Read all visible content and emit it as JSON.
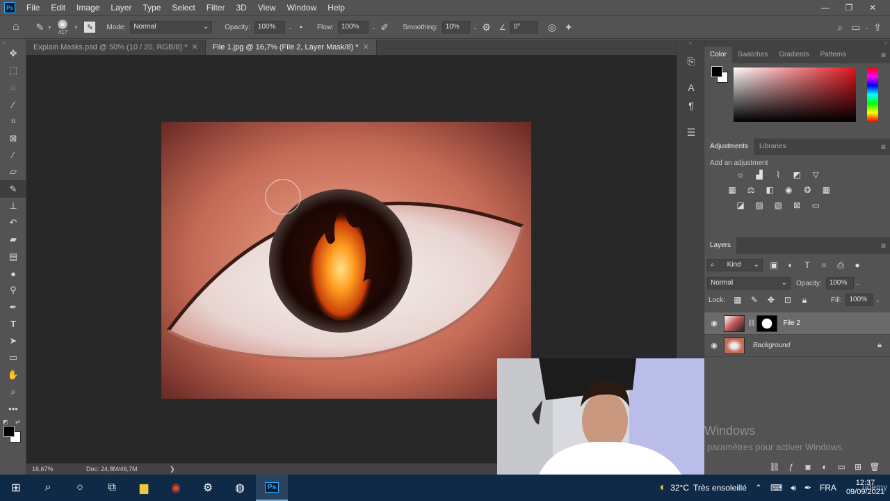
{
  "app": {
    "logo_text": "Ps"
  },
  "menu": [
    "File",
    "Edit",
    "Image",
    "Layer",
    "Type",
    "Select",
    "Filter",
    "3D",
    "View",
    "Window",
    "Help"
  ],
  "window_controls": {
    "minimize": "—",
    "restore": "❐",
    "close": "✕"
  },
  "options": {
    "brush_size": "417",
    "mode_label": "Mode:",
    "mode_value": "Normal",
    "opacity_label": "Opacity:",
    "opacity_value": "100%",
    "flow_label": "Flow:",
    "flow_value": "100%",
    "smoothing_label": "Smoothing:",
    "smoothing_value": "10%",
    "angle_value": "0°"
  },
  "tabs": [
    {
      "label": "Explain Masks.psd @ 50% (10 / 20, RGB/8) *",
      "active": false
    },
    {
      "label": "File 1.jpg @ 16,7% (File 2, Layer Mask/8) *",
      "active": true
    }
  ],
  "status": {
    "zoom": "16,67%",
    "doc": "Doc: 24,8M/46,7M",
    "arrow": "❯"
  },
  "color_panel": {
    "tabs": [
      "Color",
      "Swatches",
      "Gradients",
      "Patterns"
    ]
  },
  "adjustments_panel": {
    "tabs": [
      "Adjustments",
      "Libraries"
    ],
    "hint": "Add an adjustment"
  },
  "layers_panel": {
    "title": "Layers",
    "filter_kind": "Kind",
    "blend_mode": "Normal",
    "opacity_label": "Opacity:",
    "opacity_value": "100%",
    "lock_label": "Lock:",
    "fill_label": "Fill:",
    "fill_value": "100%",
    "layers": [
      {
        "name": "File 2",
        "selected": true
      },
      {
        "name": "Background",
        "selected": false
      }
    ]
  },
  "watermark": {
    "line1": "Windows",
    "line2": "paramètres pour activer Windows."
  },
  "taskbar": {
    "weather_temp": "32°C",
    "weather_text": "Très ensoleillé",
    "lang": "FRA",
    "time": "12:37",
    "date": "09/09/2021",
    "overlay": "udemy"
  },
  "colors": {
    "foreground": "#000000",
    "background": "#ffffff",
    "taskbar": "#0f2a47"
  }
}
